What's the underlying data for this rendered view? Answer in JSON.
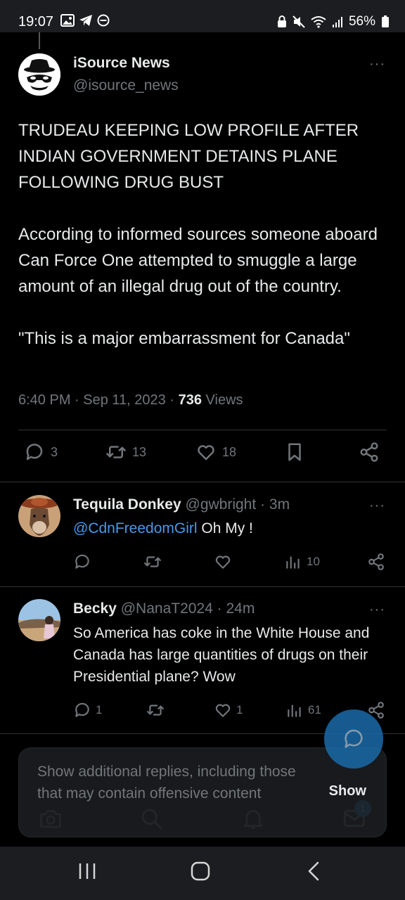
{
  "status_bar": {
    "time": "19:07",
    "battery": "56%",
    "left_icons": [
      "gallery-icon",
      "telegram-icon",
      "dnd-icon"
    ],
    "right_icons": [
      "lock-icon",
      "mute-icon",
      "wifi-icon",
      "signal-icon",
      "battery-icon"
    ]
  },
  "main_tweet": {
    "author_name": "iSource News",
    "author_handle": "@isource_news",
    "paragraphs": [
      "TRUDEAU KEEPING LOW PROFILE AFTER INDIAN GOVERNMENT DETAINS PLANE FOLLOWING DRUG BUST",
      "According to informed sources someone aboard Can Force One attempted to smuggle a large amount of an illegal drug out of the country.",
      "\"This is a major embarrassment for Canada\""
    ],
    "time": "6:40 PM",
    "date": "Sep 11, 2023",
    "views_count": "736",
    "views_label": "Views",
    "replies": "3",
    "retweets": "13",
    "likes": "18"
  },
  "replies": [
    {
      "name": "Tequila Donkey",
      "handle": "@gwbright",
      "age": "3m",
      "mention": "@CdnFreedomGirl",
      "text": "Oh My !",
      "replies": "",
      "retweets": "",
      "likes": "",
      "views": "10"
    },
    {
      "name": "Becky",
      "handle": "@NanaT2024",
      "age": "24m",
      "mention": "",
      "text": "So America has coke in the White House and Canada has large quantities of drugs on their  Presidential plane? Wow",
      "replies": "1",
      "retweets": "",
      "likes": "1",
      "views": "61"
    }
  ],
  "banner": {
    "text": "Show additional replies, including those that may contain offensive content",
    "show_label": "Show"
  },
  "tabbar": {
    "badge": "1",
    "icons": [
      "camera-icon",
      "search-icon",
      "notifications-icon",
      "messages-icon"
    ]
  },
  "separator": "·",
  "more_glyph": "···",
  "colors": {
    "background": "#000000",
    "accent": "#1d9bf0",
    "mention": "#4a99e9",
    "muted": "#71767b"
  }
}
